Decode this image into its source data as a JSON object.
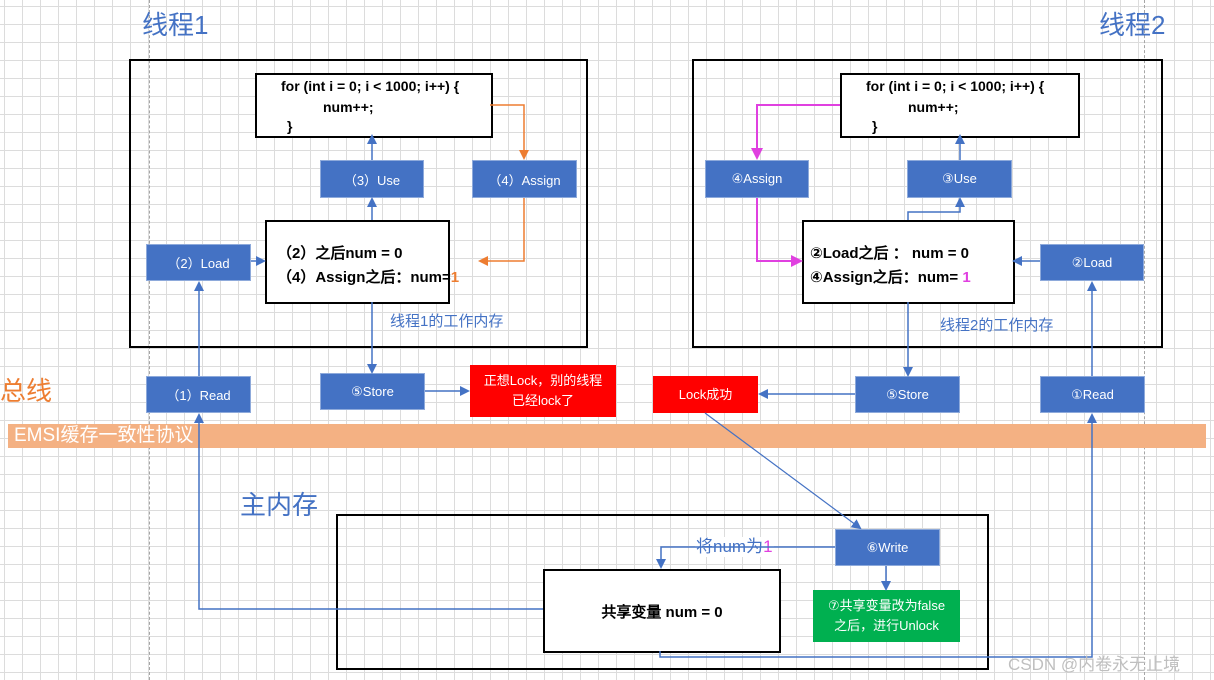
{
  "titles": {
    "thread1": "线程1",
    "thread2": "线程2",
    "bus": "总线",
    "main_memory": "主内存"
  },
  "bus_protocol": "EMSI缓存一致性协议",
  "code": {
    "line1": "for (int i = 0; i < 1000; i++) {",
    "line2": "num++;",
    "line3": "}"
  },
  "thread1": {
    "load": "（2）Load",
    "use": "（3）Use",
    "assign": "（4）Assign",
    "read": "（1）Read",
    "store": "⑤Store",
    "state_line1": "（2）之后num = 0",
    "state_line2_prefix": "（4）Assign之后：num=",
    "state_line2_value": "1",
    "working_memory_label": "线程1的工作内存",
    "lock_fail_line1": "正想Lock，别的线程",
    "lock_fail_line2": "已经lock了"
  },
  "thread2": {
    "load": "②Load",
    "use": "③Use",
    "assign": "④Assign",
    "read": "①Read",
    "store": "⑤Store",
    "state_line1": "②Load之后 ： num = 0",
    "state_line2_prefix": "④Assign之后：num= ",
    "state_line2_value": "1",
    "working_memory_label": "线程2的工作内存",
    "lock_success": "Lock成功"
  },
  "main_memory": {
    "shared_variable": "共享变量 num = 0",
    "write": "⑥Write",
    "set_label_prefix": "将num为",
    "set_label_value": "1",
    "unlock_line1": "⑦共享变量改为false",
    "unlock_line2": "之后，进行Unlock"
  },
  "colors": {
    "op_box": "#4472c4",
    "thread1_arrow": "#ed7d31",
    "thread2_arrow": "#e040e0",
    "alert": "#ff0000",
    "success": "#00b050",
    "bus_band": "#f4b183"
  },
  "watermark": "CSDN @内卷永无止境"
}
